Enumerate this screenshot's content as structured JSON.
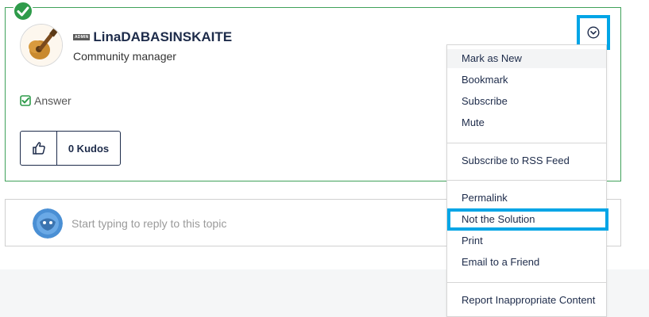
{
  "post": {
    "author_badge": "ADMIN",
    "author_name": "LinaDABASINSKAITE",
    "author_rank": "Community manager",
    "answer_label": "Answer",
    "kudos_label": "0 Kudos",
    "solved_color": "#2e9b4a",
    "icons": [
      "checkmark-solved-icon",
      "guitar-avatar-icon",
      "check-square-icon",
      "thumbs-up-icon",
      "chevron-down-circle-icon"
    ]
  },
  "reply": {
    "placeholder": "Start typing to reply to this topic"
  },
  "menu": {
    "items": [
      "Mark as New",
      "Bookmark",
      "Subscribe",
      "Mute",
      "Subscribe to RSS Feed",
      "Permalink",
      "Not the Solution",
      "Print",
      "Email to a Friend",
      "Report Inappropriate Content"
    ],
    "highlight_color": "#00a5e6"
  }
}
